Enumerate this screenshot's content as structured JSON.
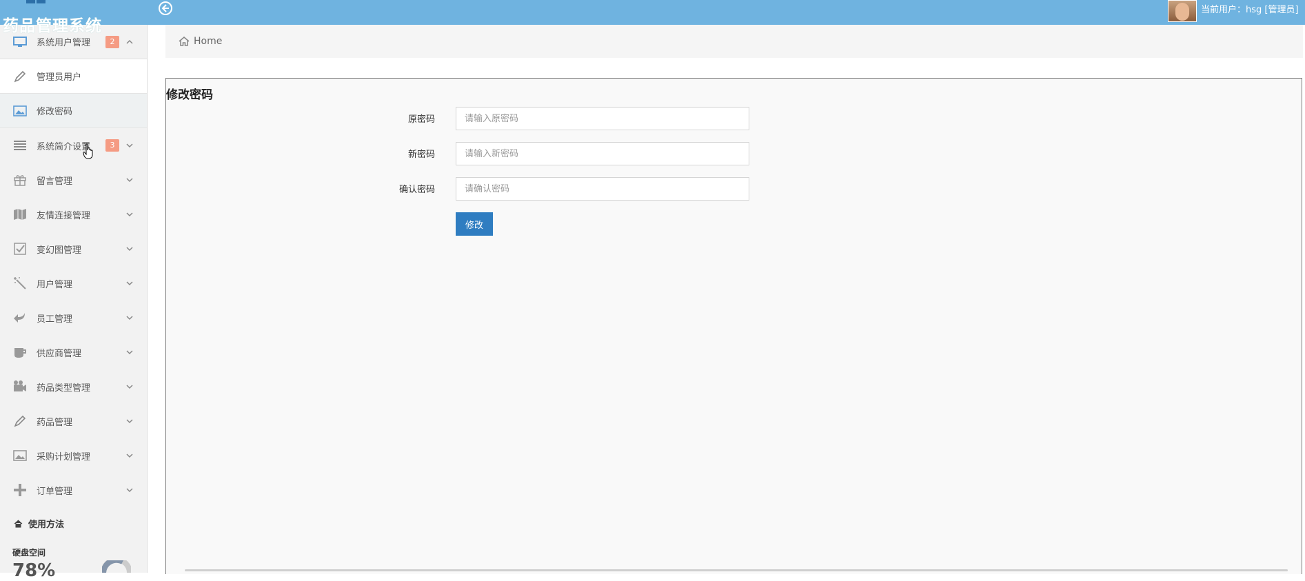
{
  "app": {
    "title": "药品管理系统",
    "current_user": "当前用户：hsg [管理员]"
  },
  "colors": {
    "topbar": "#6fb3e0",
    "badge": "#f59b83",
    "primary_button": "#2f7dc1"
  },
  "sidebar": {
    "items": [
      {
        "label": "系统用户管理",
        "icon": "desktop-icon",
        "badge": "2",
        "expanded": true
      },
      {
        "label": "管理员用户",
        "icon": "pencil-icon",
        "sub": true
      },
      {
        "label": "修改密码",
        "icon": "picture-icon",
        "sub": true,
        "active": true
      },
      {
        "label": "系统简介设置",
        "icon": "list-icon",
        "badge": "3"
      },
      {
        "label": "留言管理",
        "icon": "gift-icon"
      },
      {
        "label": "友情连接管理",
        "icon": "map-icon"
      },
      {
        "label": "变幻图管理",
        "icon": "checkbox-icon"
      },
      {
        "label": "用户管理",
        "icon": "magic-icon"
      },
      {
        "label": "员工管理",
        "icon": "reply-icon"
      },
      {
        "label": "供应商管理",
        "icon": "coffee-icon"
      },
      {
        "label": "药品类型管理",
        "icon": "film-icon"
      },
      {
        "label": "药品管理",
        "icon": "pencil-icon"
      },
      {
        "label": "采购计划管理",
        "icon": "picture-icon"
      },
      {
        "label": "订单管理",
        "icon": "plus-icon"
      }
    ],
    "help_link": "使用方法",
    "disk_label": "硬盘空间",
    "disk_percent": "78%"
  },
  "breadcrumb": {
    "home": "Home"
  },
  "form": {
    "title": "修改密码",
    "old_password_label": "原密码",
    "old_password_placeholder": "请输入原密码",
    "new_password_label": "新密码",
    "new_password_placeholder": "请输入新密码",
    "confirm_password_label": "确认密码",
    "confirm_password_placeholder": "请确认密码",
    "submit_label": "修改"
  }
}
